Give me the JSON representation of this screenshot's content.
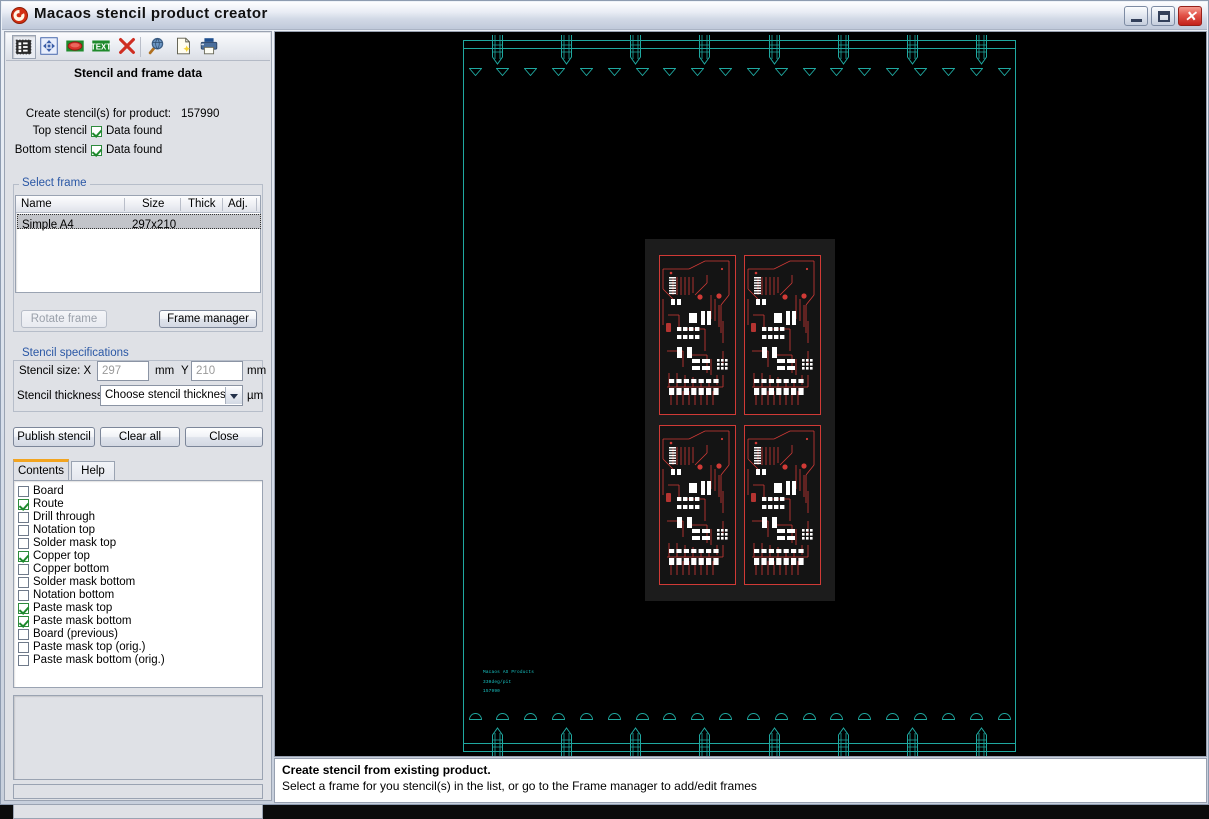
{
  "window": {
    "title": "Macaos stencil product creator",
    "logo_icon": "macaos-logo-icon",
    "minimize_label": "_",
    "maximize_label": "",
    "close_label": "✕"
  },
  "toolbar": {
    "items": [
      {
        "icon": "stencil-select-icon",
        "pressed": true
      },
      {
        "icon": "move-arrows-icon",
        "pressed": false
      },
      {
        "icon": "ellipse-shape-icon",
        "pressed": false
      },
      {
        "icon": "text-tool-icon",
        "pressed": false
      },
      {
        "icon": "delete-cross-icon",
        "pressed": false
      },
      {
        "icon": "zoom-globe-icon",
        "pressed": false
      },
      {
        "icon": "new-document-icon",
        "pressed": false
      },
      {
        "icon": "export-print-icon",
        "pressed": false
      }
    ]
  },
  "stencil_data": {
    "heading": "Stencil and frame data",
    "product_label": "Create stencil(s) for product:",
    "product_id": "157990",
    "top_stencil_label": "Top stencil",
    "top_stencil_status": "Data found",
    "top_stencil_checked": true,
    "bottom_stencil_label": "Bottom stencil",
    "bottom_stencil_status": "Data found",
    "bottom_stencil_checked": true
  },
  "select_frame": {
    "legend": "Select frame",
    "columns": [
      "Name",
      "Size",
      "Thick",
      "Adj."
    ],
    "rows": [
      {
        "name": "Simple A4",
        "size": "297x210",
        "thick": "",
        "adj": "",
        "selected": true
      }
    ],
    "rotate_button": "Rotate frame",
    "rotate_enabled": false,
    "manager_button": "Frame manager"
  },
  "stencil_specs": {
    "legend": "Stencil specifications",
    "size_label": "Stencil size: X",
    "size_x_value": "297",
    "unit_x": "mm",
    "y_label": "Y",
    "size_y_value": "210",
    "unit_y": "mm",
    "thickness_label": "Stencil thickness",
    "thickness_value": "Choose stencil thickness",
    "thickness_unit": "µm"
  },
  "actions": {
    "publish": "Publish stencil",
    "clear": "Clear all",
    "close": "Close"
  },
  "tabs": [
    {
      "label": "Contents",
      "active": true
    },
    {
      "label": "Help",
      "active": false
    }
  ],
  "contents": {
    "items": [
      {
        "label": "Board",
        "checked": false
      },
      {
        "label": "Route",
        "checked": true
      },
      {
        "label": "Drill through",
        "checked": false
      },
      {
        "label": "Notation top",
        "checked": false
      },
      {
        "label": "Solder mask top",
        "checked": false
      },
      {
        "label": "Copper top",
        "checked": true
      },
      {
        "label": "Copper bottom",
        "checked": false
      },
      {
        "label": "Solder mask bottom",
        "checked": false
      },
      {
        "label": "Notation bottom",
        "checked": false
      },
      {
        "label": "Paste mask top",
        "checked": true
      },
      {
        "label": "Paste mask bottom",
        "checked": true
      },
      {
        "label": "Board (previous)",
        "checked": false
      },
      {
        "label": "Paste mask top (orig.)",
        "checked": false
      },
      {
        "label": "Paste mask bottom (orig.)",
        "checked": false
      }
    ]
  },
  "status_bar": {
    "title": "Create stencil from existing product.",
    "hint": "Select a frame for you stencil(s) in the list, or go to the Frame manager to add/edit frames"
  },
  "canvas": {
    "background_color": "#000000",
    "frame_color": "#1fa8a0",
    "copper_color": "#d03a36",
    "paste_color": "#ffffff",
    "text_color": "#19c7c7",
    "pcb_text_lines": [
      "Macaos AS  Products",
      "330deg/pit",
      "157990"
    ],
    "clamp_count_top": 8,
    "clamp_count_bottom": 8,
    "tick_count_top": 20,
    "tick_count_bottom": 20,
    "boards_rows": 2,
    "boards_cols": 2
  }
}
